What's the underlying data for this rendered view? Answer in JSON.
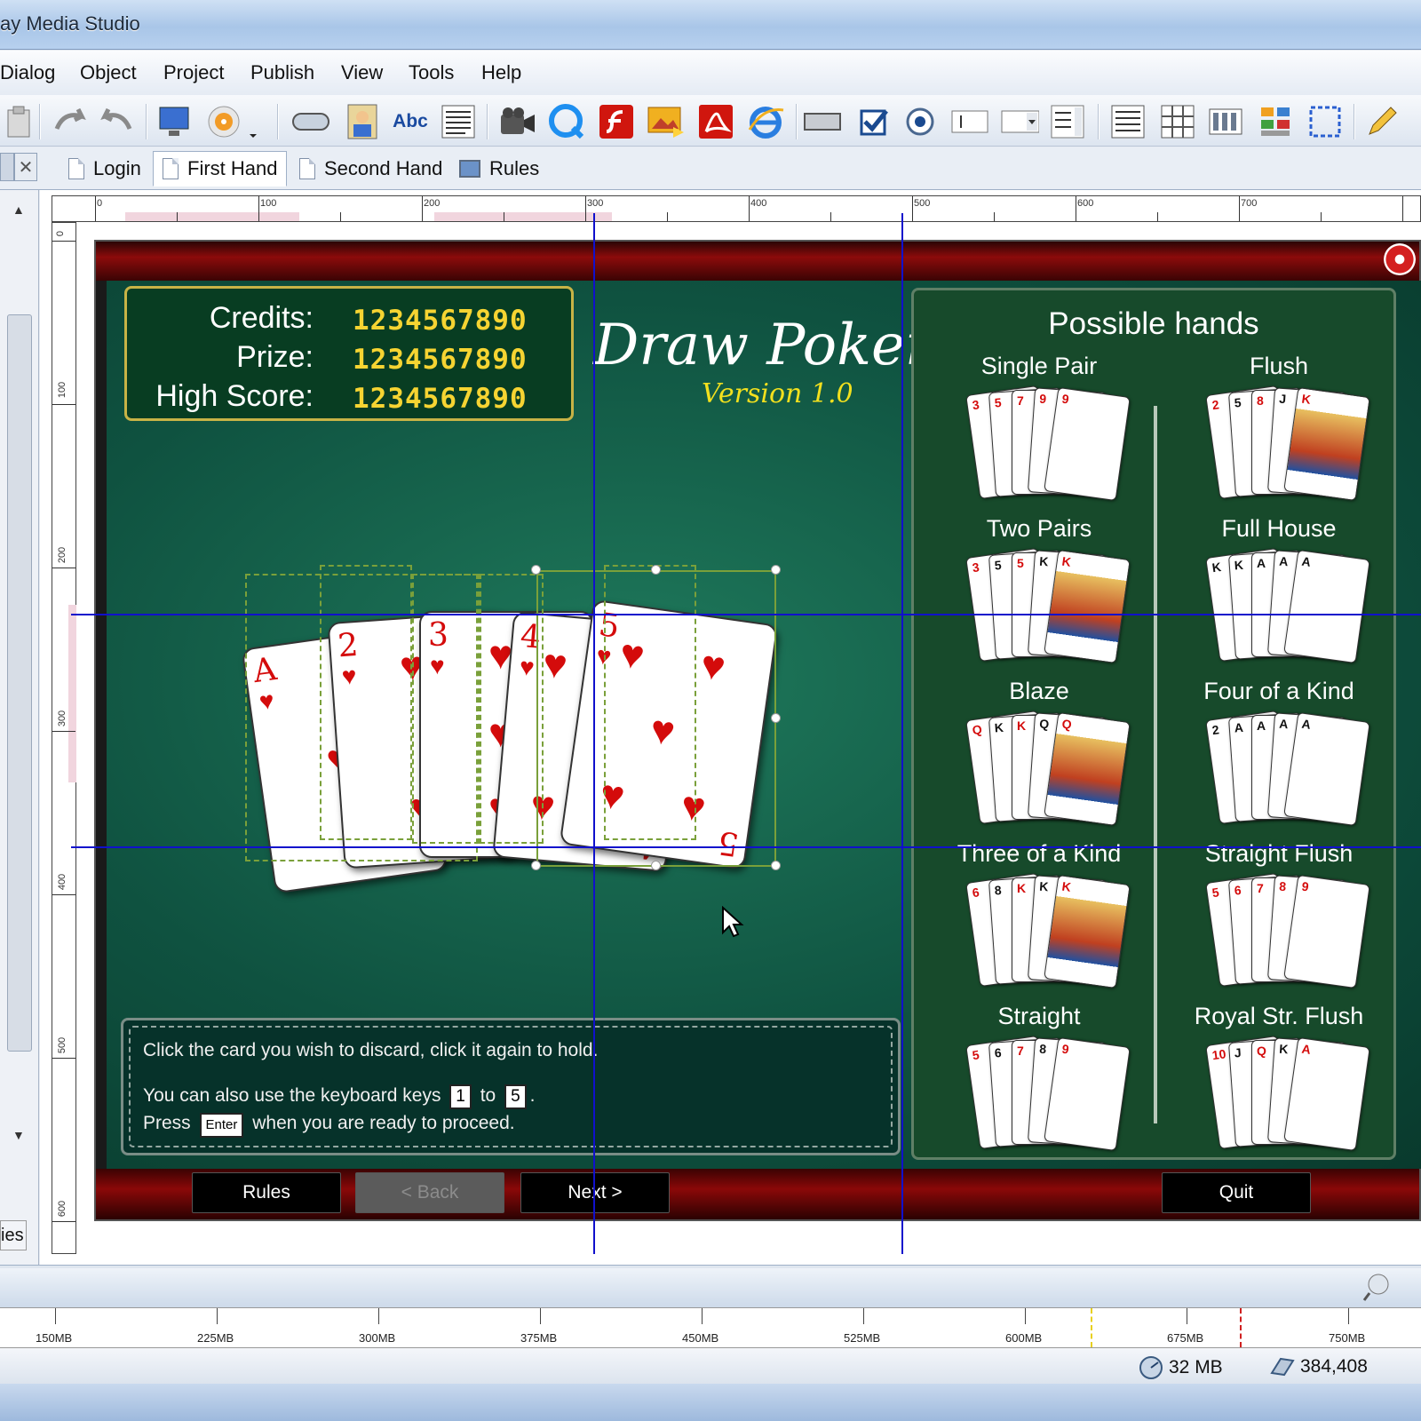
{
  "window": {
    "title": "ay Media Studio"
  },
  "menu": [
    "Dialog",
    "Object",
    "Project",
    "Publish",
    "View",
    "Tools",
    "Help"
  ],
  "toolbar": {
    "text_tool_label": "Abc"
  },
  "tabs": [
    {
      "label": "Login",
      "active": false
    },
    {
      "label": "First Hand",
      "active": true
    },
    {
      "label": "Second Hand",
      "active": false
    },
    {
      "label": "Rules",
      "active": false
    }
  ],
  "left_panel": {
    "bottom_label": "ies"
  },
  "ruler": {
    "h_labels": [
      "0",
      "100",
      "200",
      "300",
      "400",
      "500",
      "600",
      "700"
    ],
    "v_labels": [
      "0",
      "100",
      "200",
      "300",
      "400",
      "500",
      "600"
    ]
  },
  "game": {
    "title": "Draw Poker",
    "version": "Version 1.0",
    "scores": [
      {
        "label": "Credits:",
        "value": "1234567890"
      },
      {
        "label": "Prize:",
        "value": "1234567890"
      },
      {
        "label": "High Score:",
        "value": "1234567890"
      }
    ],
    "hand_cards": [
      {
        "rank": "A",
        "suit": "♥"
      },
      {
        "rank": "2",
        "suit": "♥"
      },
      {
        "rank": "3",
        "suit": "♥"
      },
      {
        "rank": "4",
        "suit": "♥"
      },
      {
        "rank": "5",
        "suit": "♥"
      }
    ],
    "info": {
      "line1": "Click the card you wish to discard, click it again to hold.",
      "line2_prefix": "You can also use the keyboard keys",
      "key_from": "1",
      "line2_mid": "to",
      "key_to": "5",
      "line2_suffix": ".",
      "line3_prefix": "Press",
      "key_enter": "Enter",
      "line3_suffix": "when you are ready to proceed."
    },
    "possible_hands": {
      "title": "Possible hands",
      "items": [
        {
          "name": "Single Pair",
          "cards": [
            "3",
            "5",
            "7",
            "9",
            "9"
          ]
        },
        {
          "name": "Flush",
          "cards": [
            "2",
            "5",
            "8",
            "J",
            "K"
          ]
        },
        {
          "name": "Two Pairs",
          "cards": [
            "3",
            "5",
            "5",
            "K",
            "K"
          ]
        },
        {
          "name": "Full House",
          "cards": [
            "K",
            "K",
            "A",
            "A",
            "A"
          ]
        },
        {
          "name": "Blaze",
          "cards": [
            "Q",
            "K",
            "K",
            "Q",
            "Q"
          ]
        },
        {
          "name": "Four of  a Kind",
          "cards": [
            "2",
            "A",
            "A",
            "A",
            "A"
          ]
        },
        {
          "name": "Three of a Kind",
          "cards": [
            "6",
            "8",
            "K",
            "K",
            "K"
          ]
        },
        {
          "name": "Straight Flush",
          "cards": [
            "5",
            "6",
            "7",
            "8",
            "9"
          ]
        },
        {
          "name": "Straight",
          "cards": [
            "5",
            "6",
            "7",
            "8",
            "9"
          ]
        },
        {
          "name": "Royal Str. Flush",
          "cards": [
            "10",
            "J",
            "Q",
            "K",
            "A"
          ]
        }
      ]
    },
    "buttons": {
      "rules": "Rules",
      "back": "< Back",
      "next": "Next >",
      "quit": "Quit"
    }
  },
  "memory": {
    "labels": [
      "150MB",
      "225MB",
      "300MB",
      "375MB",
      "450MB",
      "525MB",
      "600MB",
      "675MB",
      "750MB"
    ]
  },
  "status": {
    "memory": "32 MB",
    "size": "384,408"
  },
  "colors": {
    "felt": "#0f5240",
    "accent_red": "#8c0b0b",
    "score_gold": "#f6d432",
    "guide_blue": "#1010cc"
  }
}
